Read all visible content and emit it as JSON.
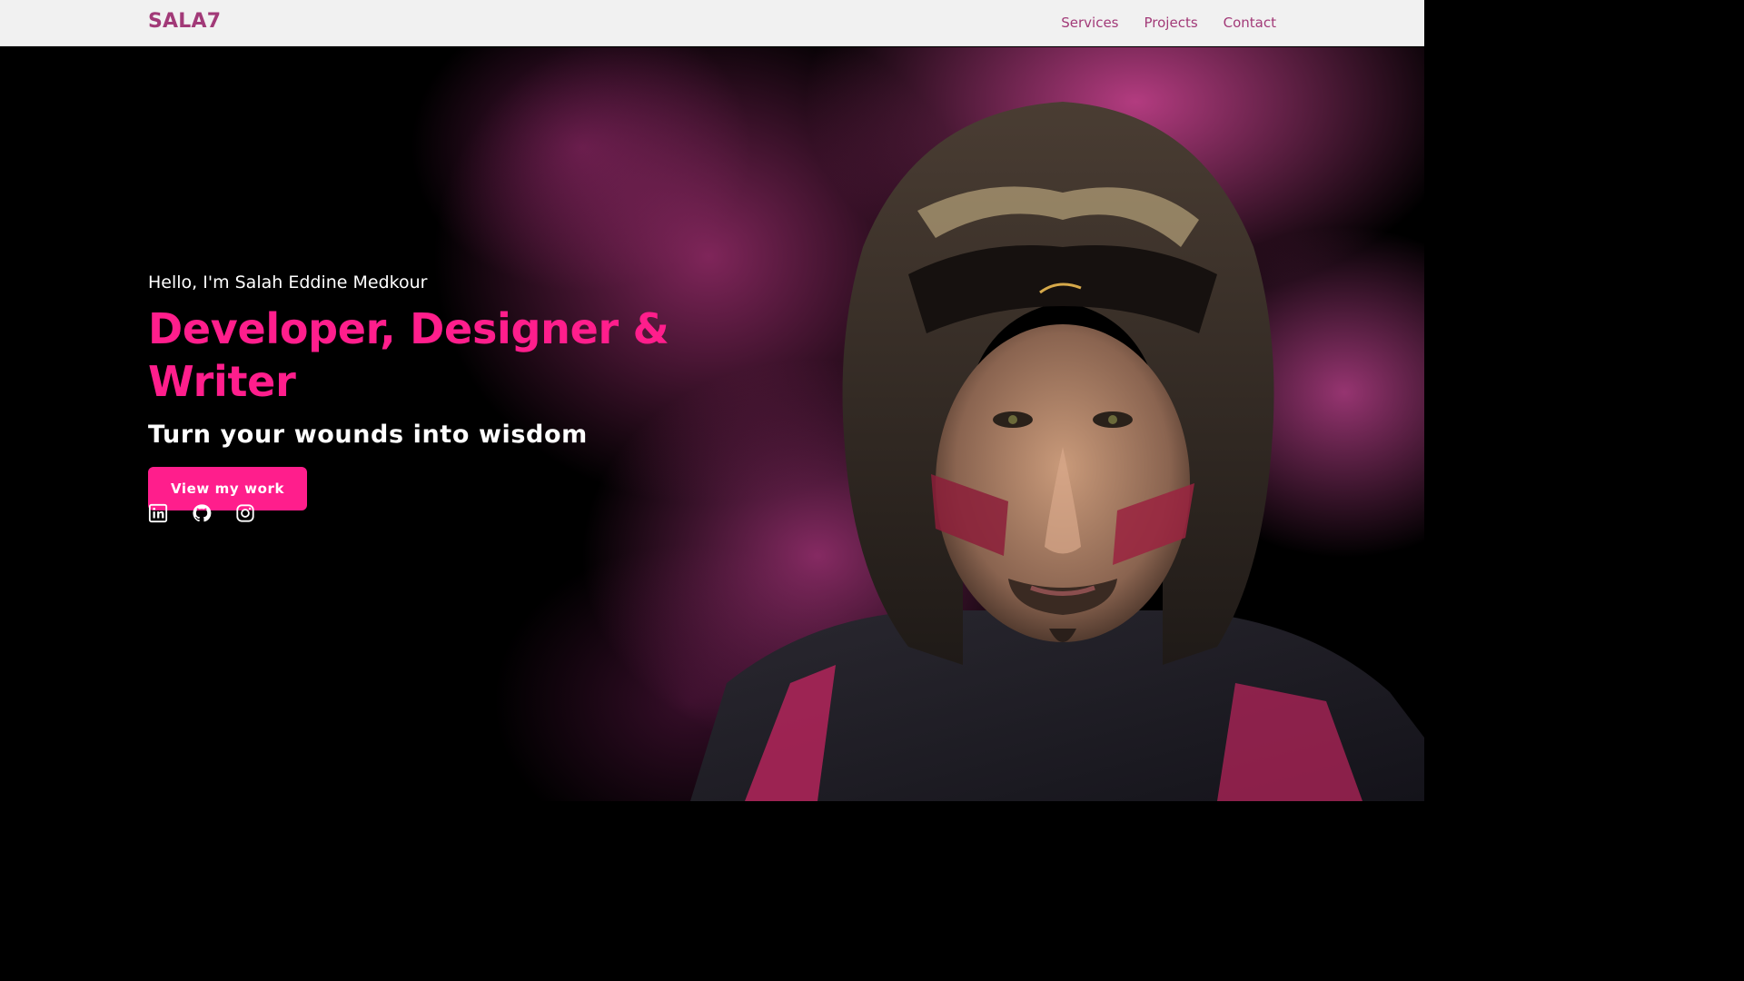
{
  "navbar": {
    "brand": "SALA7",
    "links": [
      {
        "label": "Services"
      },
      {
        "label": "Projects"
      },
      {
        "label": "Contact"
      }
    ]
  },
  "hero": {
    "greeting": "Hello, I'm Salah Eddine Medkour",
    "headline": "Developer, Designer & Writer",
    "tagline": "Turn your wounds into wisdom",
    "cta_label": "View my work"
  },
  "socials": [
    {
      "icon": "linkedin-icon"
    },
    {
      "icon": "github-icon"
    },
    {
      "icon": "instagram-icon"
    }
  ],
  "colors": {
    "accent": "#ff1e8c",
    "brand": "#a23a78",
    "navbar_bg": "#f1f1f1",
    "hero_bg": "#000000"
  }
}
